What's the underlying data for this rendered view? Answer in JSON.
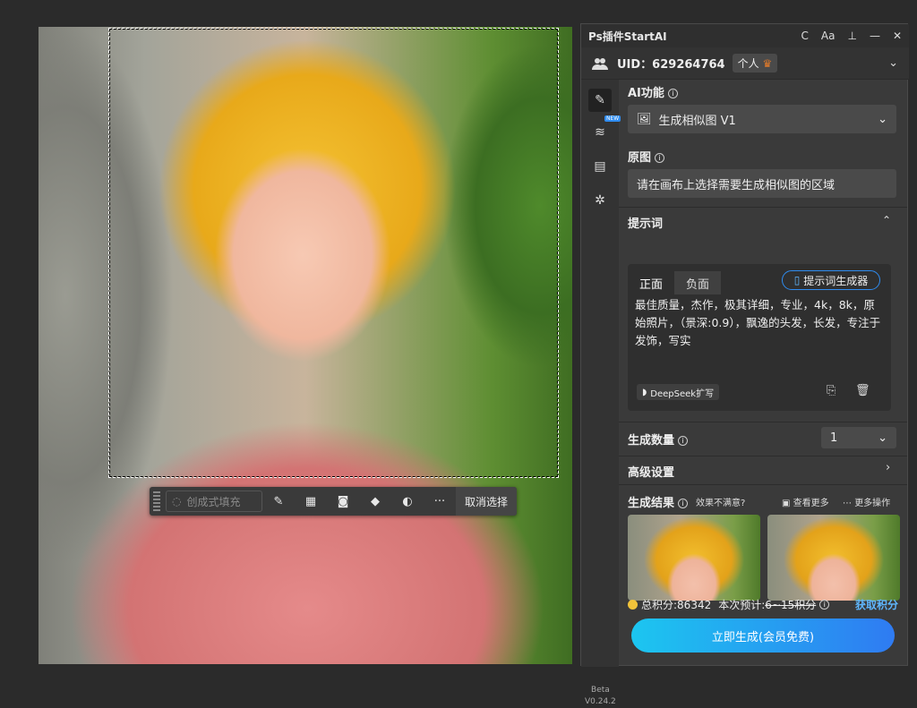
{
  "canvas": {
    "toolbar": {
      "generative_fill": "创成式填充",
      "deselect": "取消选择",
      "tools": [
        "brush-icon",
        "transform-icon",
        "mask-icon",
        "fill-icon",
        "adjust-icon",
        "more-icon"
      ]
    }
  },
  "panel": {
    "title": "Ps插件StartAI",
    "controls": [
      "refresh-icon",
      "font-icon",
      "pin-icon",
      "minimize-icon",
      "close-icon"
    ],
    "controls_glyphs": [
      "C",
      "Aa",
      "⊥",
      "—",
      "✕"
    ],
    "user": {
      "uid": "UID：629264764",
      "plan": "个人"
    },
    "ai_function": {
      "label": "AI功能",
      "value": "生成相似图 V1"
    },
    "source": {
      "label": "原图",
      "placeholder": "请在画布上选择需要生成相似图的区域"
    },
    "prompt": {
      "label": "提示词",
      "tabs": [
        "正面",
        "负面"
      ],
      "generator": "提示词生成器",
      "text": "最佳质量，杰作，极其详细，专业，4k，8k，原始照片，（景深:0.9），飘逸的头发，长发，专注于发饰，写实",
      "deepseek": "DeepSeek扩写"
    },
    "count": {
      "label": "生成数量",
      "value": "1"
    },
    "advanced": {
      "label": "高级设置"
    },
    "results": {
      "label": "生成结果",
      "unsatisfied": "效果不满意?",
      "view_more": "查看更多",
      "more_actions": "更多操作"
    },
    "points": {
      "total": "总积分:86342",
      "estimate_label": "本次预计:",
      "estimate_value": "6~15积分",
      "get": "获取积分"
    },
    "generate_button": "立即生成(会员免费)",
    "version": {
      "beta": "Beta",
      "number": "V0.24.2"
    },
    "new_tag": "NEW"
  },
  "colors": {
    "accent_blue": "#2f8cf0",
    "gradient_start": "#1cc6f0",
    "gradient_end": "#2f7bf2",
    "link_blue": "#5fb7ff",
    "coin": "#f0c23a"
  }
}
